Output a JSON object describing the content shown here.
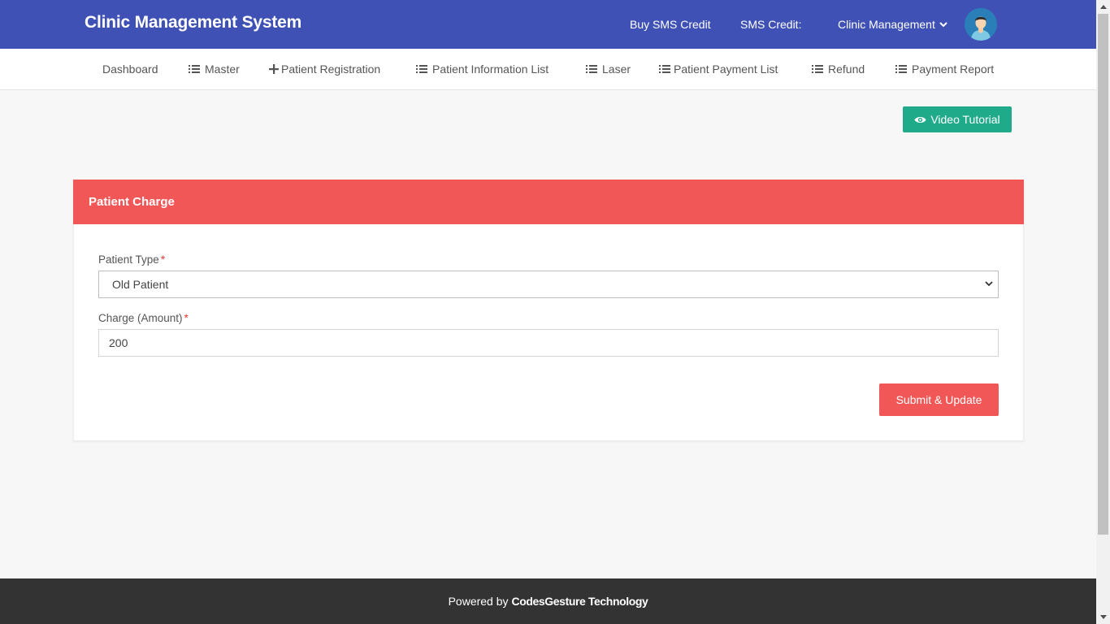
{
  "header": {
    "brand": "Clinic Management System",
    "buy_sms": "Buy SMS Credit",
    "sms_credit": "SMS Credit:",
    "user_menu": "Clinic Management"
  },
  "nav": [
    {
      "label": "Dashboard",
      "icon": "none"
    },
    {
      "label": "Master",
      "icon": "list-icon"
    },
    {
      "label": "Patient Registration",
      "icon": "plus-icon"
    },
    {
      "label": "Patient Information List",
      "icon": "list-icon"
    },
    {
      "label": "Laser",
      "icon": "list-icon"
    },
    {
      "label": "Patient Payment List",
      "icon": "list-icon"
    },
    {
      "label": "Refund",
      "icon": "list-icon"
    },
    {
      "label": "Payment Report",
      "icon": "list-icon"
    }
  ],
  "video_button": "Video Tutorial",
  "card": {
    "title": "Patient Charge",
    "patient_type_label": "Patient Type",
    "patient_type_value": "Old Patient",
    "charge_label": "Charge (Amount)",
    "charge_value": "200",
    "required_mark": "*",
    "submit": "Submit & Update"
  },
  "footer": {
    "prefix": "Powered by",
    "company": "CodesGesture Technology"
  },
  "colors": {
    "header_bg": "#3f51b5",
    "accent_red": "#f25757",
    "teal": "#1fab89",
    "footer_bg": "#333333"
  }
}
